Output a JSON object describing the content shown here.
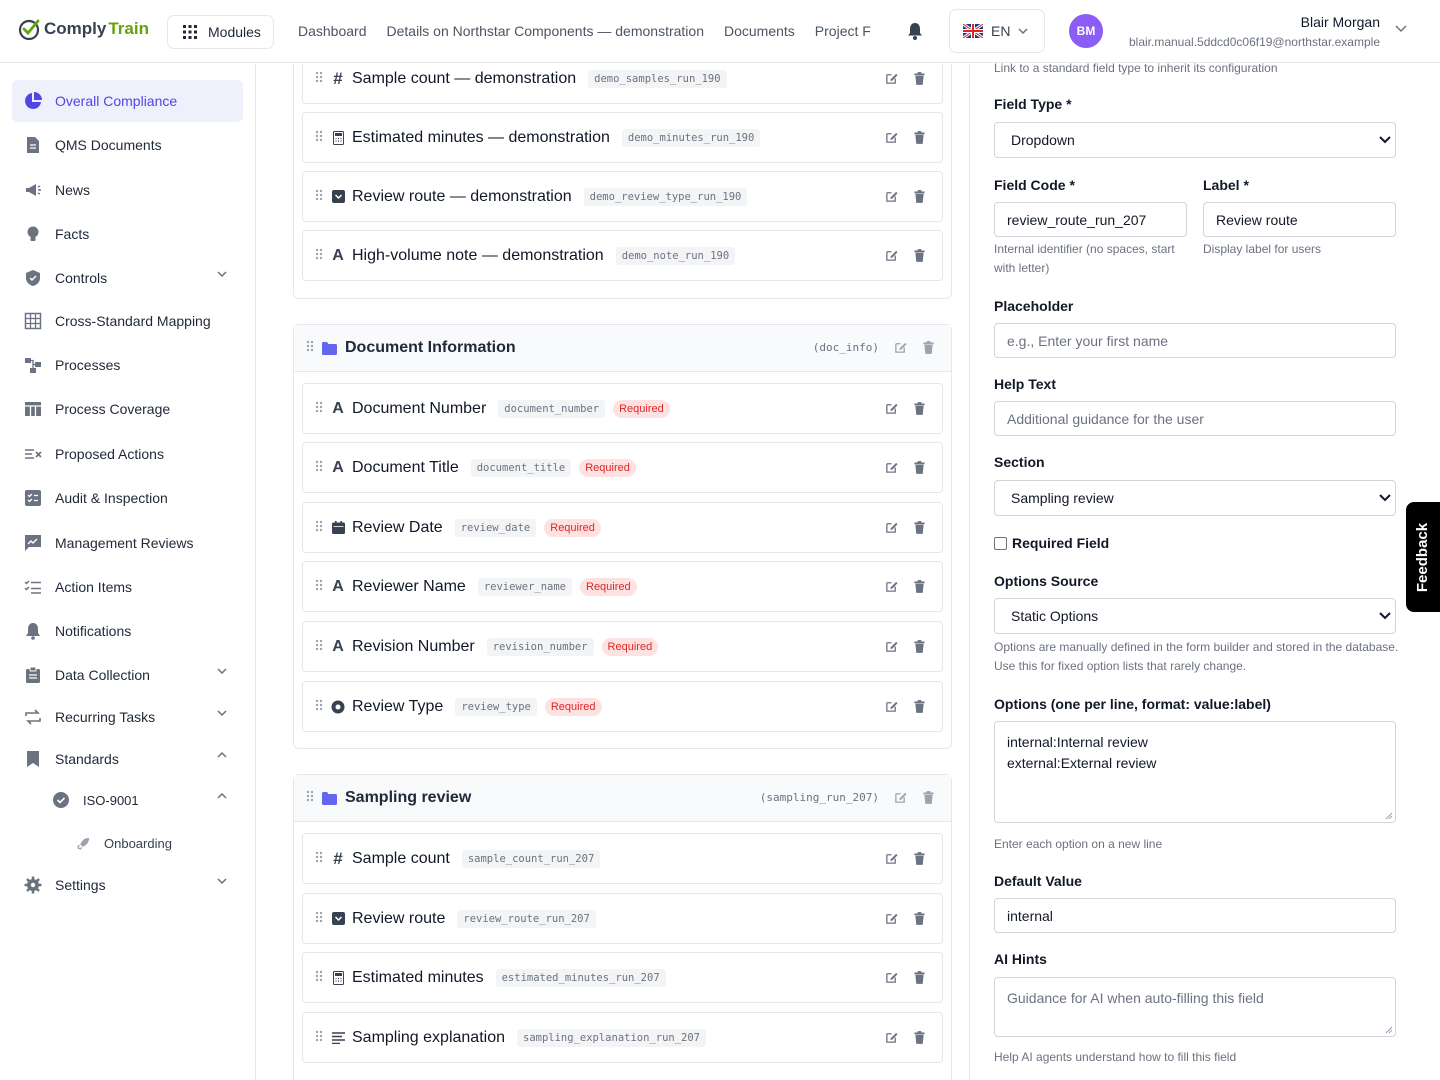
{
  "brand": {
    "name_part1": "Comply",
    "name_part2": "Train"
  },
  "topbar": {
    "modules_label": "Modules",
    "nav": [
      "Dashboard",
      "Details on Northstar Components — demonstration",
      "Documents",
      "Project F"
    ],
    "lang": "EN",
    "user_initials": "BM",
    "user_name": "Blair Morgan",
    "user_email": "blair.manual.5ddcd0c06f19@northstar.example"
  },
  "sidebar": {
    "items": [
      {
        "label": "Overall Compliance",
        "icon": "pie-chart-icon",
        "active": true
      },
      {
        "label": "QMS Documents",
        "icon": "document-icon"
      },
      {
        "label": "News",
        "icon": "megaphone-icon"
      },
      {
        "label": "Facts",
        "icon": "lightbulb-icon"
      },
      {
        "label": "Controls",
        "icon": "shield-icon",
        "chevron": "down"
      },
      {
        "label": "Cross-Standard Mapping",
        "icon": "grid-icon"
      },
      {
        "label": "Processes",
        "icon": "flow-icon"
      },
      {
        "label": "Process Coverage",
        "icon": "table-icon"
      },
      {
        "label": "Proposed Actions",
        "icon": "list-x-icon"
      },
      {
        "label": "Audit & Inspection",
        "icon": "checklist-icon"
      },
      {
        "label": "Management Reviews",
        "icon": "chart-icon"
      },
      {
        "label": "Action Items",
        "icon": "tasks-icon"
      },
      {
        "label": "Notifications",
        "icon": "bell-icon"
      },
      {
        "label": "Data Collection",
        "icon": "clipboard-icon",
        "chevron": "down"
      },
      {
        "label": "Recurring Tasks",
        "icon": "repeat-icon",
        "chevron": "down"
      },
      {
        "label": "Standards",
        "icon": "bookmark-icon",
        "chevron": "up"
      },
      {
        "label": "ISO-9001",
        "icon": "badge-check-icon",
        "chevron": "up"
      },
      {
        "label": "Onboarding",
        "icon": "rocket-icon"
      },
      {
        "label": "Settings",
        "icon": "gear-icon",
        "chevron": "down"
      }
    ]
  },
  "top_group": {
    "fields": [
      {
        "label": "Sample count — demonstration",
        "code": "demo_samples_run_190",
        "type": "number"
      },
      {
        "label": "Estimated minutes — demonstration",
        "code": "demo_minutes_run_190",
        "type": "calculator"
      },
      {
        "label": "Review route — demonstration",
        "code": "demo_review_type_run_190",
        "type": "dropdown"
      },
      {
        "label": "High-volume note — demonstration",
        "code": "demo_note_run_190",
        "type": "text"
      }
    ]
  },
  "sections": [
    {
      "title": "Document Information",
      "code": "(doc_info)",
      "fields": [
        {
          "label": "Document Number",
          "code": "document_number",
          "type": "text",
          "required": "Required"
        },
        {
          "label": "Document Title",
          "code": "document_title",
          "type": "text",
          "required": "Required"
        },
        {
          "label": "Review Date",
          "code": "review_date",
          "type": "date",
          "required": "Required"
        },
        {
          "label": "Reviewer Name",
          "code": "reviewer_name",
          "type": "text",
          "required": "Required"
        },
        {
          "label": "Revision Number",
          "code": "revision_number",
          "type": "text",
          "required": "Required"
        },
        {
          "label": "Review Type",
          "code": "review_type",
          "type": "radio",
          "required": "Required"
        }
      ]
    },
    {
      "title": "Sampling review",
      "code": "(sampling_run_207)",
      "fields": [
        {
          "label": "Sample count",
          "code": "sample_count_run_207",
          "type": "number"
        },
        {
          "label": "Review route",
          "code": "review_route_run_207",
          "type": "dropdown"
        },
        {
          "label": "Estimated minutes",
          "code": "estimated_minutes_run_207",
          "type": "calculator"
        },
        {
          "label": "Sampling explanation",
          "code": "sampling_explanation_run_207",
          "type": "textarea"
        }
      ]
    }
  ],
  "panel": {
    "top_help": "Link to a standard field type to inherit its configuration",
    "field_type_label": "Field Type *",
    "field_type_value": "Dropdown",
    "field_code_label": "Field Code *",
    "field_code_value": "review_route_run_207",
    "field_code_help": "Internal identifier (no spaces, start with letter)",
    "label_label": "Label *",
    "label_value": "Review route",
    "label_help": "Display label for users",
    "placeholder_label": "Placeholder",
    "placeholder_ph": "e.g., Enter your first name",
    "help_text_label": "Help Text",
    "help_text_ph": "Additional guidance for the user",
    "section_label": "Section",
    "section_value": "Sampling review",
    "required_label": "Required Field",
    "options_source_label": "Options Source",
    "options_source_value": "Static Options",
    "options_source_help": "Options are manually defined in the form builder and stored in the database. Use this for fixed option lists that rarely change.",
    "options_label": "Options (one per line, format: value:label)",
    "options_lines": [
      "internal:Internal review",
      "external:External review"
    ],
    "options_help": "Enter each option on a new line",
    "default_label": "Default Value",
    "default_value": "internal",
    "ai_label": "AI Hints",
    "ai_ph": "Guidance for AI when auto-filling this field",
    "ai_help": "Help AI agents understand how to fill this field"
  },
  "feedback_label": "Feedback",
  "colors": {
    "accent": "#4f46e5",
    "brand_green": "#65a30d",
    "folder": "#6366f1",
    "required_bg": "#fee2e2",
    "required_text": "#dc2626"
  }
}
